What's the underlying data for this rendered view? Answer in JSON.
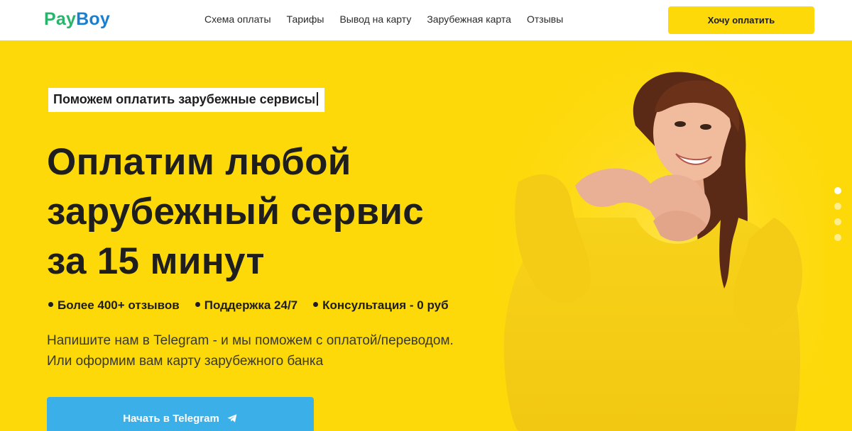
{
  "header": {
    "logo_part1": "Pay",
    "logo_part2": "Boy",
    "nav": [
      "Схема оплаты",
      "Тарифы",
      "Вывод на карту",
      "Зарубежная карта",
      "Отзывы"
    ],
    "cta": "Хочу оплатить"
  },
  "hero": {
    "tagline": "Поможем оплатить зарубежные сервисы",
    "headline_line1": "Оплатим любой",
    "headline_line2": "зарубежный сервис",
    "headline_line3": "за 15 минут",
    "bullets": [
      "Более 400+ отзывов",
      "Поддержка 24/7",
      "Консультация - 0 руб"
    ],
    "desc_line1": "Напишите нам в Telegram - и мы поможем с оплатой/переводом.",
    "desc_line2": "Или оформим вам карту зарубежного банка",
    "cta": "Начать в Telegram",
    "cta_icon": "telegram-plane-icon"
  },
  "slider": {
    "count": 4,
    "active": 1
  },
  "colors": {
    "accent_yellow": "#fdd90a",
    "telegram_blue": "#3aafe8",
    "logo_green": "#2ab36b",
    "logo_blue": "#1b7fcf",
    "text_dark": "#1e1e1e"
  }
}
